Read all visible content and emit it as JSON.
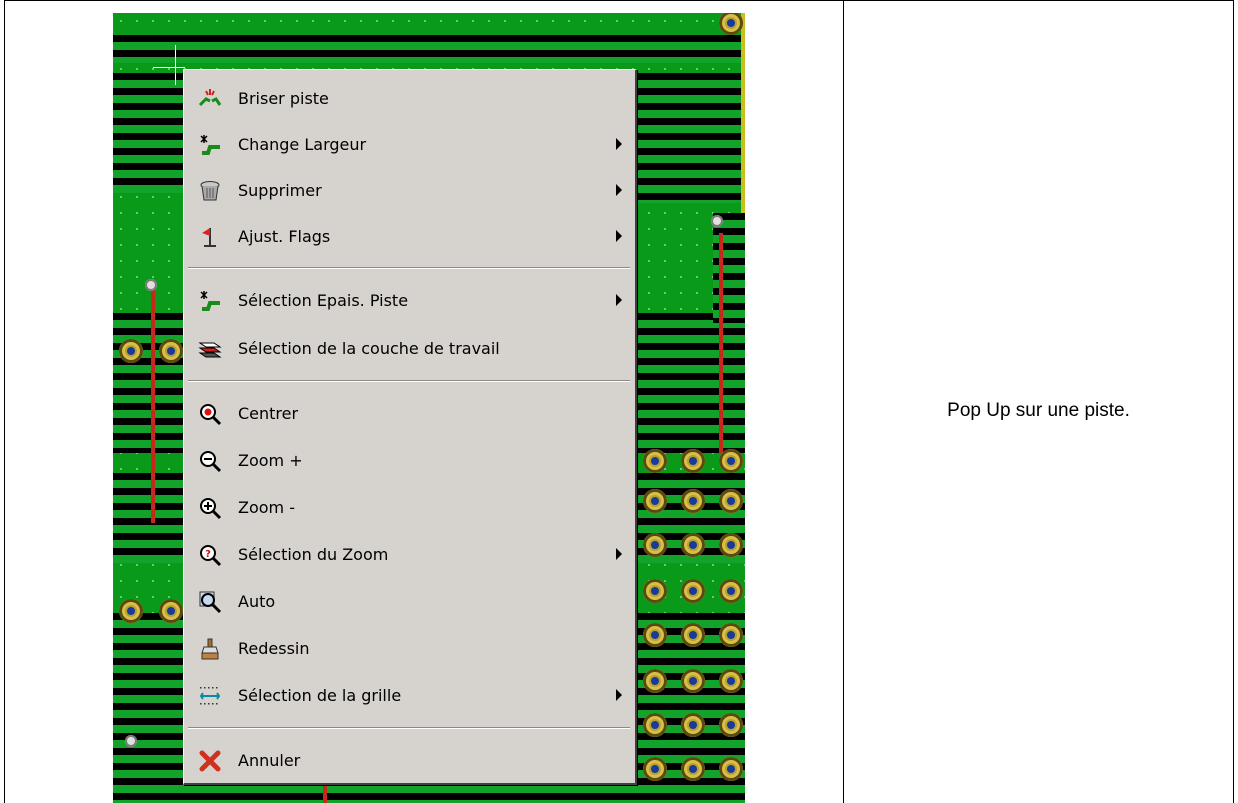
{
  "menu": {
    "items": [
      {
        "label": "Briser piste",
        "icon": "break-track-icon",
        "submenu": false
      },
      {
        "label": "Change Largeur",
        "icon": "track-width-icon",
        "submenu": true
      },
      {
        "label": "Supprimer",
        "icon": "trash-icon",
        "submenu": true
      },
      {
        "label": "Ajust. Flags",
        "icon": "flag-icon",
        "submenu": true
      },
      {
        "label": "Sélection Epais. Piste",
        "icon": "track-width-icon",
        "submenu": true
      },
      {
        "label": "Sélection de la couche de travail",
        "icon": "layers-icon",
        "submenu": false
      },
      {
        "label": "Centrer",
        "icon": "zoom-center-icon",
        "submenu": false
      },
      {
        "label": "Zoom +",
        "icon": "zoom-in-icon",
        "submenu": false
      },
      {
        "label": "Zoom -",
        "icon": "zoom-out-icon",
        "submenu": false
      },
      {
        "label": "Sélection du Zoom",
        "icon": "zoom-select-icon",
        "submenu": true
      },
      {
        "label": "Auto",
        "icon": "zoom-auto-icon",
        "submenu": false
      },
      {
        "label": "Redessin",
        "icon": "redraw-brush-icon",
        "submenu": false
      },
      {
        "label": "Sélection de la grille",
        "icon": "grid-icon",
        "submenu": true
      },
      {
        "label": "Annuler",
        "icon": "cancel-x-icon",
        "submenu": false
      }
    ]
  },
  "caption": "Pop Up sur une piste.",
  "colors": {
    "menu_bg": "#d6d3ce",
    "pcb_green": "#0a9a1a",
    "track_red": "#c8281c",
    "pad_gold": "#b8a030"
  }
}
